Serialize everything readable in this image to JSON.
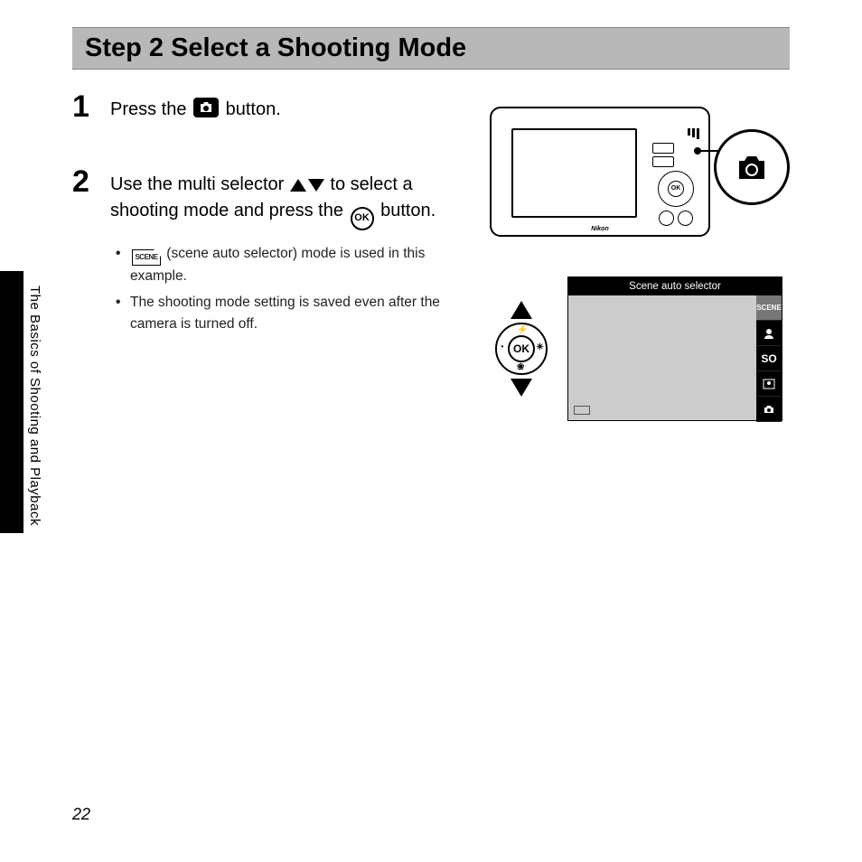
{
  "heading": "Step 2 Select a Shooting Mode",
  "sidebar_label": "The Basics of Shooting and Playback",
  "page_number": "22",
  "step1": {
    "num": "1",
    "text_before": "Press the ",
    "text_after": " button."
  },
  "step2": {
    "num": "2",
    "text_a": "Use the multi selector ",
    "text_b": " to select a shooting mode and press the ",
    "text_c": " button.",
    "bullet1_a": " (scene auto selector) mode is used in this example.",
    "bullet2": "The shooting mode setting is saved even after the camera is turned off."
  },
  "ok_label": "OK",
  "scene_label": "SCENE",
  "camera_brand": "Nikon",
  "menu": {
    "title": "Scene auto selector",
    "items": [
      "SCENE",
      "",
      "SO",
      "",
      ""
    ]
  }
}
